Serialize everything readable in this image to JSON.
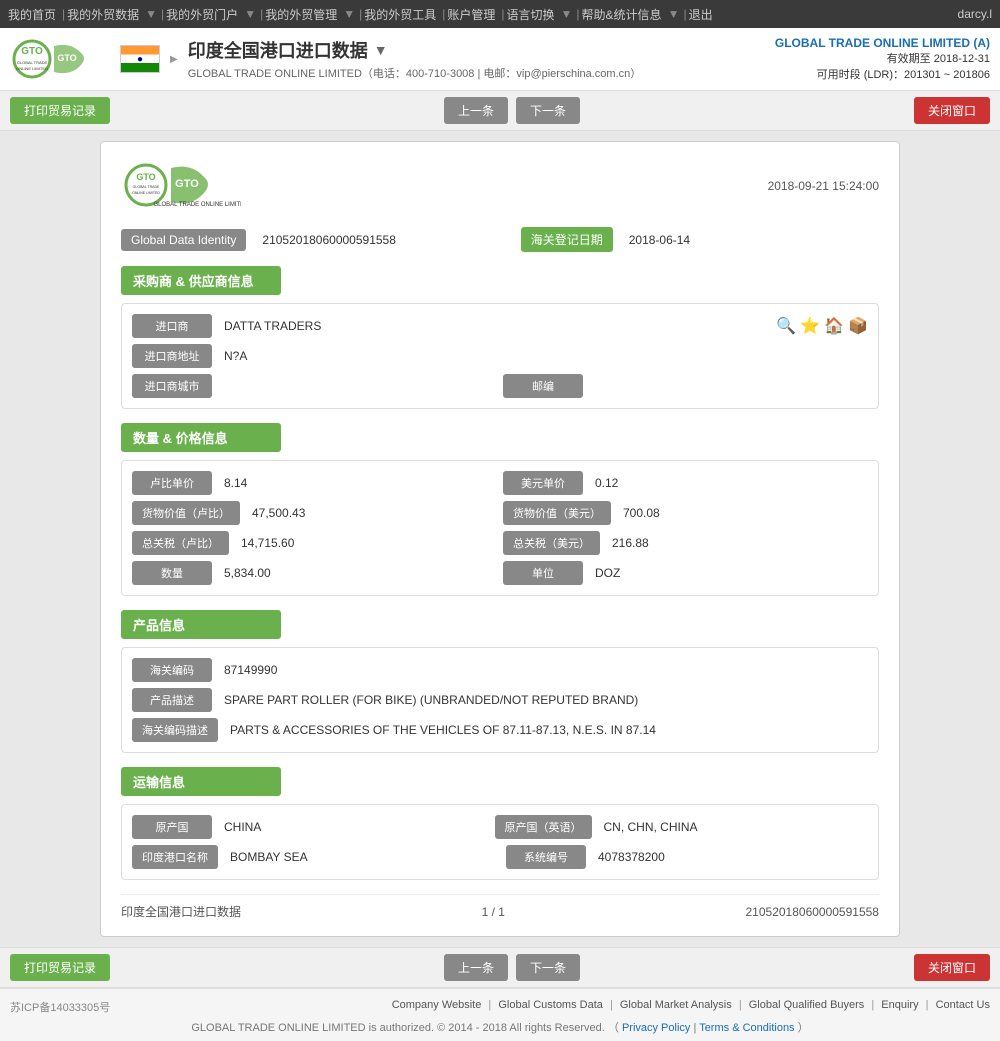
{
  "topnav": {
    "items": [
      "我的首页",
      "我的外贸数据",
      "我的外贸门户",
      "我的外贸管理",
      "我的外贸工具",
      "账户管理",
      "语言切换",
      "帮助&统计信息",
      "退出"
    ],
    "user": "darcy.l"
  },
  "header": {
    "title": "印度全国港口进口数据",
    "company_top": "GLOBAL TRADE ONLINE LIMITED (A)",
    "validity": "有效期至 2018-12-31",
    "ldr": "可用时段 (LDR)：201301 ~ 201806",
    "phone": "电话：400-710-3008",
    "email": "电邮：vip@pierschina.com.cn",
    "subtitle": "GLOBAL TRADE ONLINE LIMITED（电话：400-710-3008 | 电邮：vip@pierschina.com.cn）"
  },
  "toolbar": {
    "print_label": "打印贸易记录",
    "prev_label": "上一条",
    "next_label": "下一条",
    "close_label": "关闭窗口"
  },
  "record": {
    "datetime": "2018-09-21 15:24:00",
    "global_data_identity_label": "Global Data Identity",
    "global_data_identity_value": "21052018060000591558",
    "customs_date_label": "海关登记日期",
    "customs_date_value": "2018-06-14",
    "section_buyer_supplier": "采购商 & 供应商信息",
    "importer_label": "进口商",
    "importer_value": "DATTA TRADERS",
    "importer_address_label": "进口商地址",
    "importer_address_value": "N?A",
    "importer_city_label": "进口商城市",
    "importer_city_value": "",
    "postcode_label": "邮编",
    "postcode_value": "",
    "section_quantity_price": "数量 & 价格信息",
    "unit_price_inr_label": "卢比单价",
    "unit_price_inr_value": "8.14",
    "unit_price_usd_label": "美元单价",
    "unit_price_usd_value": "0.12",
    "cargo_value_inr_label": "货物价值（卢比）",
    "cargo_value_inr_value": "47,500.43",
    "cargo_value_usd_label": "货物价值（美元）",
    "cargo_value_usd_value": "700.08",
    "total_duty_inr_label": "总关税（卢比）",
    "total_duty_inr_value": "14,715.60",
    "total_duty_usd_label": "总关税（美元）",
    "total_duty_usd_value": "216.88",
    "quantity_label": "数量",
    "quantity_value": "5,834.00",
    "unit_label": "单位",
    "unit_value": "DOZ",
    "section_product": "产品信息",
    "hs_code_label": "海关编码",
    "hs_code_value": "87149990",
    "product_desc_label": "产品描述",
    "product_desc_value": "SPARE PART ROLLER (FOR BIKE) (UNBRANDED/NOT REPUTED BRAND)",
    "hs_code_desc_label": "海关编码描述",
    "hs_code_desc_value": "PARTS & ACCESSORIES OF THE VEHICLES OF 87.11-87.13, N.E.S. IN 87.14",
    "section_transport": "运输信息",
    "origin_country_label": "原产国",
    "origin_country_value": "CHINA",
    "origin_country_en_label": "原产国（英语）",
    "origin_country_en_value": "CN, CHN, CHINA",
    "india_port_label": "印度港口名称",
    "india_port_value": "BOMBAY SEA",
    "system_code_label": "系统编号",
    "system_code_value": "4078378200",
    "footer_left": "印度全国港口进口数据",
    "footer_mid": "1 / 1",
    "footer_right": "21052018060000591558"
  },
  "page_footer": {
    "links": [
      "Company Website",
      "Global Customs Data",
      "Global Market Analysis",
      "Global Qualified Buyers",
      "Enquiry",
      "Contact Us"
    ],
    "copyright": "GLOBAL TRADE ONLINE LIMITED is authorized. © 2014 - 2018 All rights Reserved.  （",
    "privacy": "Privacy Policy",
    "separator": "|",
    "terms": "Terms & Conditions",
    "copyright_end": "）",
    "icp": "苏ICP备14033305号"
  }
}
